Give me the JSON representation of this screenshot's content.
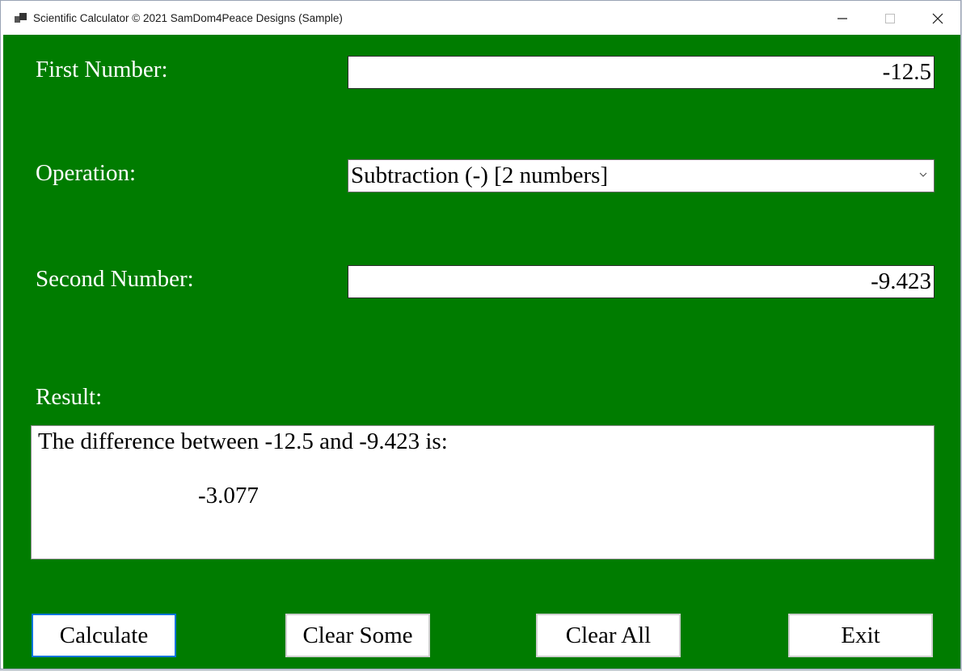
{
  "window": {
    "title": "Scientific Calculator © 2021 SamDom4Peace Designs (Sample)",
    "controls": [
      "minimize",
      "maximize",
      "close"
    ]
  },
  "form": {
    "first_number": {
      "label": "First Number:",
      "value": "-12.5"
    },
    "operation": {
      "label": "Operation:",
      "selected": "Subtraction (-) [2 numbers]"
    },
    "second_number": {
      "label": "Second Number:",
      "value": "-9.423"
    },
    "result": {
      "label": "Result:",
      "line1": "The difference between -12.5 and -9.423 is:",
      "line2": "-3.077"
    }
  },
  "buttons": {
    "calculate": "Calculate",
    "clear_some": "Clear Some",
    "clear_all": "Clear All",
    "exit": "Exit"
  },
  "colors": {
    "background": "#007c00",
    "focus_border": "#0a74da"
  }
}
